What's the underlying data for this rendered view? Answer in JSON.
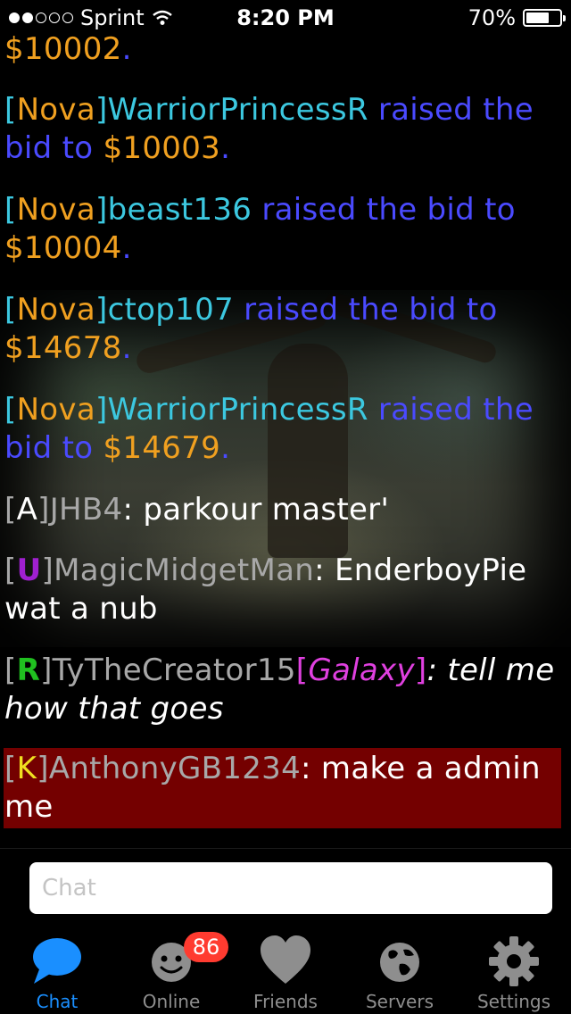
{
  "status_bar": {
    "carrier": "Sprint",
    "time": "8:20 PM",
    "battery_percent": "70%",
    "battery_level": 0.7,
    "signal_bars_filled": 2,
    "signal_bars_total": 5,
    "icons": [
      "signal-dots-icon",
      "wifi-icon",
      "battery-icon"
    ]
  },
  "messages": [
    {
      "amount": "$10002",
      "period": "."
    },
    {
      "tag_open": "[",
      "tag": "Nova",
      "tag_close": "]",
      "user": "WarriorPrincessR",
      "action": " raised the bid to ",
      "amount": "$10003",
      "period": "."
    },
    {
      "tag_open": "[",
      "tag": "Nova",
      "tag_close": "]",
      "user": "beast136",
      "action": " raised the bid to ",
      "amount": "$10004",
      "period": "."
    },
    {
      "tag_open": "[",
      "tag": "Nova",
      "tag_close": "]",
      "user": "ctop107",
      "action": " raised the bid to ",
      "amount": "$14678",
      "period": "."
    },
    {
      "tag_open": "[",
      "tag": "Nova",
      "tag_close": "]",
      "user": "WarriorPrincessR",
      "action": " raised the bid to ",
      "amount": "$14679",
      "period": "."
    },
    {
      "tag_open": "[",
      "tag": "A",
      "tag_close": "]",
      "user": "JHB4",
      "sep": ": ",
      "text": "parkour master'"
    },
    {
      "tag_open": "[",
      "tag": "U",
      "tag_close": "]",
      "user": "MagicMidgetMan",
      "sep": ": ",
      "text": "EnderboyPie wat a nub"
    },
    {
      "tag_open": "[",
      "tag": "R",
      "tag_close": "]",
      "user": "TyTheCreator15",
      "group_open": "[",
      "group": "Galaxy",
      "group_close": "]",
      "sep": ": ",
      "text": "tell me how that goes"
    },
    {
      "tag_open": "[",
      "tag": "K",
      "tag_close": "]",
      "user": "AnthonyGB1234",
      "sep": ": ",
      "text": "make a admin me"
    }
  ],
  "colors": {
    "system_text": "#4a4aff",
    "amount": "#f0a020",
    "nova_tag": "#f0a020",
    "nova_user": "#3cc8e0",
    "tag_U": "#a020d0",
    "tag_R": "#20c020",
    "tag_K": "#f0e020",
    "group_galaxy": "#e040e0",
    "highlight_bg": "#740000",
    "active_tab": "#1a8fff",
    "badge": "#ff3b30"
  },
  "input": {
    "placeholder": "Chat",
    "value": ""
  },
  "tabs": [
    {
      "label": "Chat",
      "icon": "chat-bubble-icon",
      "active": true
    },
    {
      "label": "Online",
      "icon": "smiley-face-icon",
      "badge": "86",
      "active": false
    },
    {
      "label": "Friends",
      "icon": "heart-icon",
      "active": false
    },
    {
      "label": "Servers",
      "icon": "globe-icon",
      "active": false
    },
    {
      "label": "Settings",
      "icon": "gear-icon",
      "active": false
    }
  ]
}
